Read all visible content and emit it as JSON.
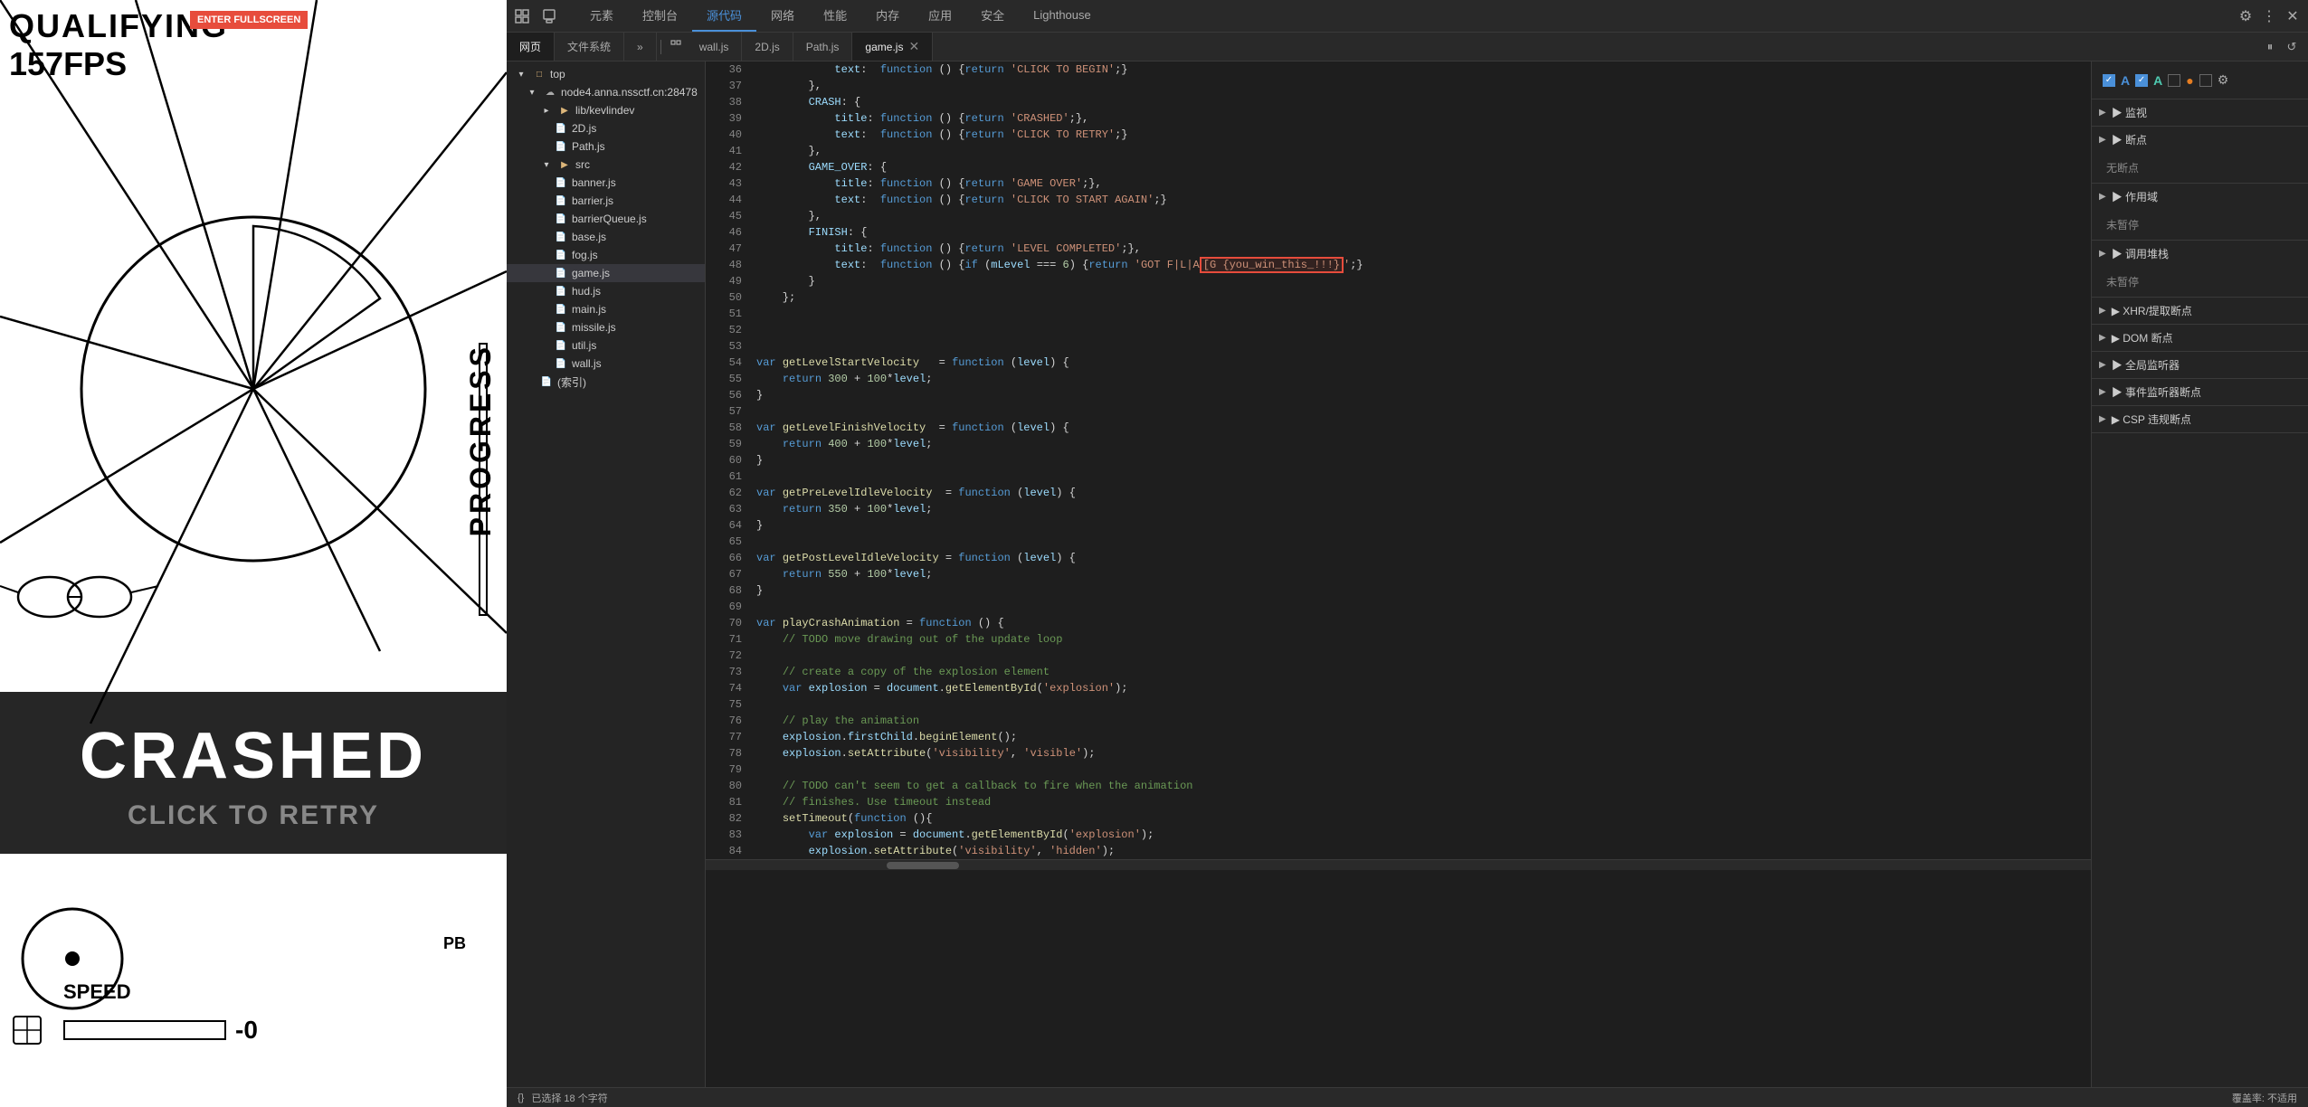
{
  "game": {
    "title": "QUALIFYING",
    "fps": "157FPS",
    "enter_fullscreen": "ENTER FULLSCREEN",
    "crashed": "CRASHED",
    "click_retry": "CLICK TO RETRY",
    "speed_label": "SPEED",
    "speed_value": "-0",
    "pb_label": "PB",
    "progress_label": "PROGRESS"
  },
  "devtools": {
    "toolbar_tabs": [
      "元素",
      "控制台",
      "源代码",
      "网络",
      "性能",
      "内存",
      "应用",
      "安全",
      "Lighthouse"
    ],
    "active_tab": "源代码",
    "file_tabs": [
      "网页",
      "文件系统"
    ],
    "more_label": "»",
    "open_files": [
      "wall.js",
      "2D.js",
      "Path.js",
      "game.js"
    ],
    "active_file": "game.js",
    "status_chars": "已选择 18 个字符",
    "coverage": "覆盖率: 不适用",
    "file_tree": {
      "root": "top",
      "server": "node4.anna.nssctf.cn:28478",
      "folders": [
        {
          "name": "lib/kevlindev",
          "indent": 2,
          "children": [
            "2D.js",
            "Path.js"
          ]
        },
        {
          "name": "src",
          "indent": 2,
          "children": [
            "banner.js",
            "barrier.js",
            "barrierQueue.js",
            "base.js",
            "fog.js",
            "game.js",
            "hud.js",
            "main.js",
            "missile.js",
            "util.js",
            "wall.js"
          ]
        }
      ],
      "index_file": "(索引)"
    }
  },
  "debugger": {
    "watch_label": "▶ 监视",
    "breakpoints_label": "▶ 断点",
    "no_breakpoints": "无断点",
    "scope_label": "▶ 作用域",
    "not_paused": "未暂停",
    "call_stack_label": "▶ 调用堆栈",
    "not_paused2": "未暂停",
    "xhr_label": "▶ XHR/提取断点",
    "dom_label": "▶ DOM 断点",
    "global_label": "▶ 全局监听器",
    "event_label": "▶ 事件监听器断点",
    "csp_label": "▶ CSP 违规断点",
    "checkboxes": [
      "A",
      "A",
      "●",
      "⚙"
    ]
  },
  "code_lines": [
    {
      "num": "36",
      "content": "            text:  function () {return 'CLICK TO BEGIN';}",
      "type": "mixed"
    },
    {
      "num": "37",
      "content": "        },",
      "type": "plain"
    },
    {
      "num": "38",
      "content": "        CRASH: {",
      "type": "mixed"
    },
    {
      "num": "39",
      "content": "            title: function () {return 'CRASHED';},",
      "type": "mixed"
    },
    {
      "num": "40",
      "content": "            text:  function () {return 'CLICK TO RETRY';}",
      "type": "mixed"
    },
    {
      "num": "41",
      "content": "        },",
      "type": "plain"
    },
    {
      "num": "42",
      "content": "        GAME_OVER: {",
      "type": "mixed"
    },
    {
      "num": "43",
      "content": "            title: function () {return 'GAME OVER';},",
      "type": "mixed"
    },
    {
      "num": "44",
      "content": "            text:  function () {return 'CLICK TO START AGAIN';}",
      "type": "mixed"
    },
    {
      "num": "45",
      "content": "        },",
      "type": "plain"
    },
    {
      "num": "46",
      "content": "        FINISH: {",
      "type": "mixed"
    },
    {
      "num": "47",
      "content": "            title: function () {return 'LEVEL COMPLETED';},",
      "type": "mixed"
    },
    {
      "num": "48",
      "content": "            text:  function () {if (mLevel === 6) {return 'GOT F|L|A[G {you_win_this_!!!}';}",
      "type": "mixed",
      "highlight": true
    },
    {
      "num": "49",
      "content": "        }",
      "type": "plain"
    },
    {
      "num": "50",
      "content": "    };",
      "type": "plain"
    },
    {
      "num": "51",
      "content": "",
      "type": "plain"
    },
    {
      "num": "52",
      "content": "",
      "type": "plain"
    },
    {
      "num": "53",
      "content": "",
      "type": "plain"
    },
    {
      "num": "54",
      "content": "var getLevelStartVelocity   = function (level) {",
      "type": "mixed"
    },
    {
      "num": "55",
      "content": "    return 300 + 100*level;",
      "type": "mixed"
    },
    {
      "num": "56",
      "content": "}",
      "type": "plain"
    },
    {
      "num": "57",
      "content": "",
      "type": "plain"
    },
    {
      "num": "58",
      "content": "var getLevelFinishVelocity  = function (level) {",
      "type": "mixed"
    },
    {
      "num": "59",
      "content": "    return 400 + 100*level;",
      "type": "mixed"
    },
    {
      "num": "60",
      "content": "}",
      "type": "plain"
    },
    {
      "num": "61",
      "content": "",
      "type": "plain"
    },
    {
      "num": "62",
      "content": "var getPreLevelIdleVelocity  = function (level) {",
      "type": "mixed"
    },
    {
      "num": "63",
      "content": "    return 350 + 100*level;",
      "type": "mixed"
    },
    {
      "num": "64",
      "content": "}",
      "type": "plain"
    },
    {
      "num": "65",
      "content": "",
      "type": "plain"
    },
    {
      "num": "66",
      "content": "var getPostLevelIdleVelocity = function (level) {",
      "type": "mixed"
    },
    {
      "num": "67",
      "content": "    return 550 + 100*level;",
      "type": "mixed"
    },
    {
      "num": "68",
      "content": "}",
      "type": "plain"
    },
    {
      "num": "69",
      "content": "",
      "type": "plain"
    },
    {
      "num": "70",
      "content": "var playCrashAnimation = function () {",
      "type": "mixed"
    },
    {
      "num": "71",
      "content": "    // TODO move drawing out of the update loop",
      "type": "comment"
    },
    {
      "num": "72",
      "content": "",
      "type": "plain"
    },
    {
      "num": "73",
      "content": "    // create a copy of the explosion element",
      "type": "comment"
    },
    {
      "num": "74",
      "content": "    var explosion = document.getElementById('explosion');",
      "type": "mixed"
    },
    {
      "num": "75",
      "content": "",
      "type": "plain"
    },
    {
      "num": "76",
      "content": "    // play the animation",
      "type": "comment"
    },
    {
      "num": "77",
      "content": "    explosion.firstChild.beginElement();",
      "type": "mixed"
    },
    {
      "num": "78",
      "content": "    explosion.setAttribute('visibility', 'visible');",
      "type": "mixed"
    },
    {
      "num": "79",
      "content": "",
      "type": "plain"
    },
    {
      "num": "80",
      "content": "    // TODO can't seem to get a callback to fire when the animation",
      "type": "comment"
    },
    {
      "num": "81",
      "content": "    // finishes. Use timeout instead",
      "type": "comment"
    },
    {
      "num": "82",
      "content": "    setTimeout(function (){",
      "type": "mixed"
    },
    {
      "num": "83",
      "content": "        var explosion = document.getElementById('explosion');",
      "type": "mixed"
    },
    {
      "num": "84",
      "content": "        explosion.setAttribute('visibility', 'hidden');",
      "type": "mixed"
    }
  ]
}
